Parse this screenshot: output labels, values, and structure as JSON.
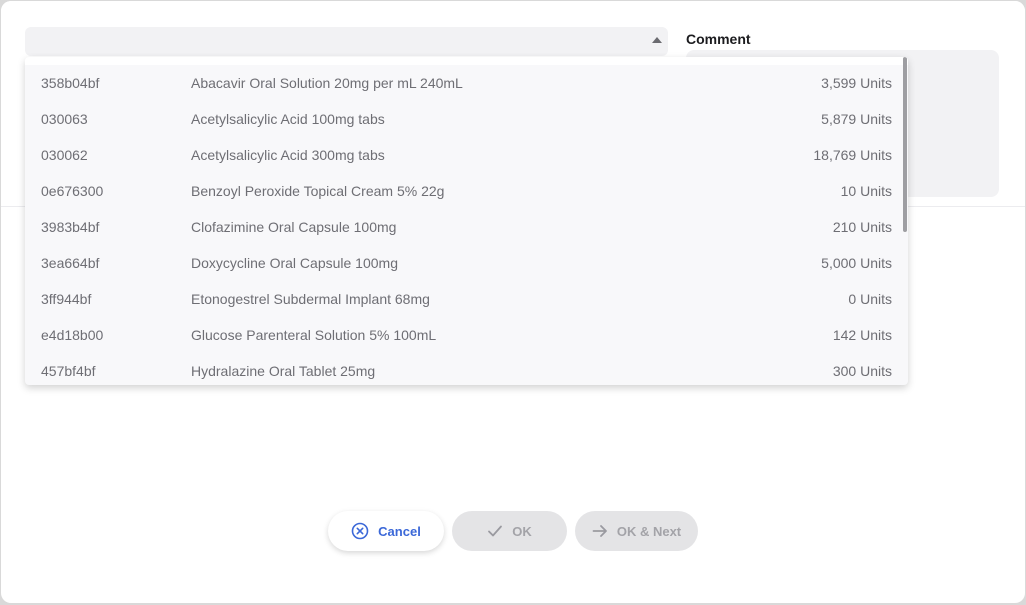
{
  "form": {
    "comment_label": "Comment",
    "comment_value": ""
  },
  "dropdown": {
    "items": [
      {
        "code": "358b04bf",
        "name": "Abacavir Oral Solution 20mg per mL 240mL",
        "quantity": "3,599 Units"
      },
      {
        "code": "030063",
        "name": "Acetylsalicylic Acid 100mg tabs",
        "quantity": "5,879 Units"
      },
      {
        "code": "030062",
        "name": "Acetylsalicylic Acid 300mg tabs",
        "quantity": "18,769 Units"
      },
      {
        "code": "0e676300",
        "name": "Benzoyl Peroxide Topical Cream 5% 22g",
        "quantity": "10 Units"
      },
      {
        "code": "3983b4bf",
        "name": "Clofazimine Oral Capsule 100mg",
        "quantity": "210 Units"
      },
      {
        "code": "3ea664bf",
        "name": "Doxycycline Oral Capsule 100mg",
        "quantity": "5,000 Units"
      },
      {
        "code": "3ff944bf",
        "name": "Etonogestrel Subdermal Implant 68mg",
        "quantity": "0 Units"
      },
      {
        "code": "e4d18b00",
        "name": "Glucose Parenteral Solution 5% 100mL",
        "quantity": "142 Units"
      },
      {
        "code": "457bf4bf",
        "name": "Hydralazine Oral Tablet 25mg",
        "quantity": "300 Units"
      }
    ]
  },
  "actions": {
    "cancel_label": "Cancel",
    "ok_label": "OK",
    "ok_next_label": "OK & Next"
  },
  "colors": {
    "accent": "#3b68d8",
    "disabled_text": "#a3a3a8",
    "disabled_bg": "#e4e4e6"
  }
}
